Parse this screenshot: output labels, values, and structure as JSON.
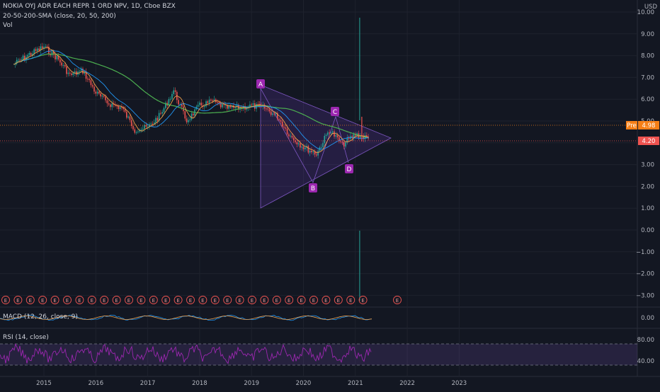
{
  "header": {
    "symbol_line": "NOKIA OYJ ADR EACH REPR 1 ORD NPV, 1D, Cboe BZX",
    "sma_line": "20-50-200-SMA (close, 20, 50, 200)",
    "vol_line": "Vol",
    "currency": "USD"
  },
  "price_axis": {
    "ticks": [
      "10.00",
      "9.00",
      "8.00",
      "7.00",
      "6.00",
      "5.00",
      "4.00",
      "3.00",
      "2.00",
      "1.00",
      "0.00",
      "−1.00",
      "−2.00",
      "−3.00"
    ]
  },
  "markers": {
    "pre_label": "Pre",
    "pre_value": "4.98",
    "last_value": "4.20"
  },
  "pattern": {
    "points": [
      "A",
      "B",
      "C",
      "D"
    ]
  },
  "earnings": {
    "label": "E",
    "count": 31
  },
  "macd": {
    "label": "MACD (12, 26, close, 9)",
    "tick": "0.00"
  },
  "rsi": {
    "label": "RSI (14, close)",
    "ticks": [
      "80.00",
      "40.00"
    ]
  },
  "time_axis": {
    "labels": [
      "2015",
      "2016",
      "2017",
      "2018",
      "2019",
      "2020",
      "2021",
      "2022",
      "2023"
    ]
  },
  "colors": {
    "background": "#131722",
    "candle_up": "#26a69a",
    "candle_down": "#ef5350",
    "sma20": "#f0a04b",
    "sma50": "#2196f3",
    "sma200": "#4caf50",
    "pattern_fill": "#673ab7",
    "pattern_label": "#9c27b0",
    "rsi_line": "#9c27b0",
    "pre_tag": "#f57f17",
    "last_tag": "#ef5350"
  },
  "chart_data": {
    "type": "line",
    "title": "NOKIA OYJ ADR EACH REPR 1 ORD NPV, 1D, Cboe BZX",
    "xlabel": "",
    "ylabel": "USD",
    "ylim": [
      -3.4,
      10.2
    ],
    "x": [
      "2014-06",
      "2014-10",
      "2015-01",
      "2015-04",
      "2015-07",
      "2015-10",
      "2016-01",
      "2016-04",
      "2016-07",
      "2016-10",
      "2017-01",
      "2017-04",
      "2017-07",
      "2017-10",
      "2018-01",
      "2018-04",
      "2018-07",
      "2018-10",
      "2019-01",
      "2019-04",
      "2019-07",
      "2019-10",
      "2020-01",
      "2020-04",
      "2020-07",
      "2020-10",
      "2021-01",
      "2021-04"
    ],
    "series": [
      {
        "values": [
          7.6,
          8.1,
          8.4,
          7.9,
          7.1,
          7.3,
          6.3,
          5.8,
          5.6,
          4.6,
          4.7,
          5.3,
          6.4,
          5.0,
          5.7,
          5.9,
          5.6,
          5.6,
          5.7,
          5.6,
          5.2,
          4.3,
          3.8,
          3.5,
          4.6,
          3.9,
          4.4,
          4.2
        ]
      }
    ],
    "annotations": [
      {
        "label": "A",
        "x": "2019-03",
        "y": 6.4
      },
      {
        "label": "B",
        "x": "2020-03",
        "y": 2.5
      },
      {
        "label": "C",
        "x": "2020-08",
        "y": 5.0
      },
      {
        "label": "D",
        "x": "2021-01",
        "y": 3.3
      }
    ],
    "triangle_pattern": [
      {
        "x": "2019-03",
        "y": 6.5
      },
      {
        "x": "2021-09",
        "y": 4.2
      },
      {
        "x": "2019-03",
        "y": 1.1
      }
    ],
    "grid": true
  }
}
